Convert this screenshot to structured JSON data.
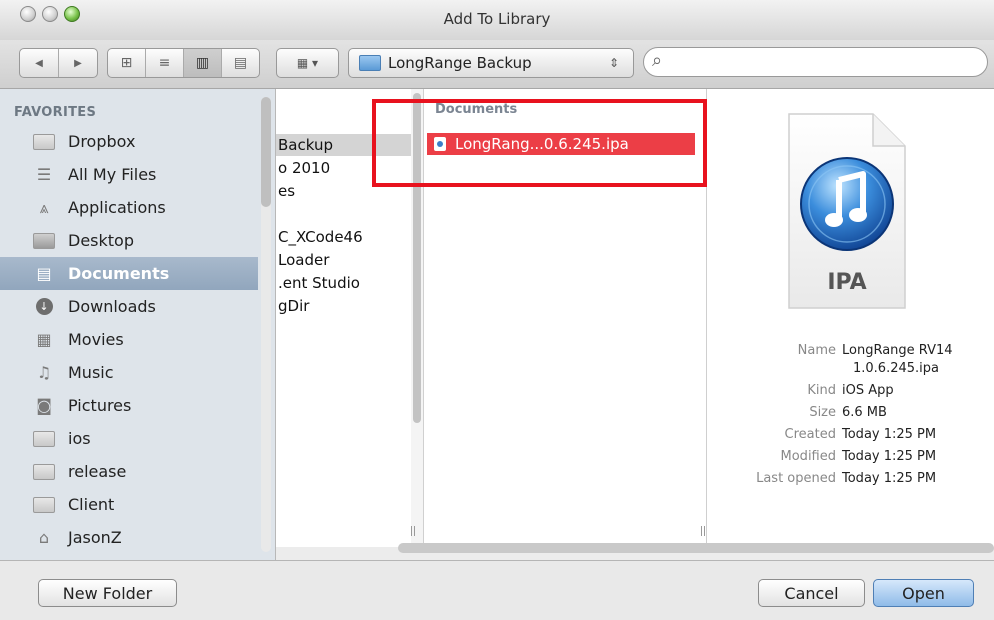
{
  "window": {
    "title": "Add To Library"
  },
  "toolbar": {
    "nav_back": "◀",
    "nav_forward": "▶",
    "view_icons": "⊞",
    "view_list": "≡",
    "view_columns": "▥",
    "view_coverflow": "▤",
    "arrange": "▦ ▾",
    "location": "LongRange Backup",
    "location_stepper": "⇕",
    "search_icon": "⌕",
    "search_placeholder": ""
  },
  "sidebar": {
    "header": "FAVORITES",
    "items": [
      {
        "label": "Dropbox",
        "icon": "folder-icon"
      },
      {
        "label": "All My Files",
        "icon": "all-files-icon"
      },
      {
        "label": "Applications",
        "icon": "applications-icon"
      },
      {
        "label": "Desktop",
        "icon": "desktop-icon"
      },
      {
        "label": "Documents",
        "icon": "documents-icon",
        "selected": true
      },
      {
        "label": "Downloads",
        "icon": "downloads-icon"
      },
      {
        "label": "Movies",
        "icon": "movies-icon"
      },
      {
        "label": "Music",
        "icon": "music-icon"
      },
      {
        "label": "Pictures",
        "icon": "pictures-icon"
      },
      {
        "label": "ios",
        "icon": "folder-icon"
      },
      {
        "label": "release",
        "icon": "folder-icon"
      },
      {
        "label": "Client",
        "icon": "folder-icon"
      },
      {
        "label": "JasonZ",
        "icon": "home-icon"
      }
    ]
  },
  "column1": {
    "items": [
      "Backup",
      "o 2010",
      "es",
      "",
      "C_XCode46",
      "Loader",
      ".ent Studio",
      "gDir"
    ]
  },
  "column2": {
    "header": "Documents",
    "file": "LongRang...0.6.245.ipa"
  },
  "preview": {
    "icon_label": "IPA",
    "name_key": "Name",
    "name_line1": "LongRange RV14",
    "name_line2": "1.0.6.245.ipa",
    "kind_key": "Kind",
    "kind": "iOS App",
    "size_key": "Size",
    "size": "6.6 MB",
    "created_key": "Created",
    "created": "Today 1:25 PM",
    "modified_key": "Modified",
    "modified": "Today 1:25 PM",
    "last_opened_key": "Last opened",
    "last_opened": "Today 1:25 PM"
  },
  "buttons": {
    "new_folder": "New Folder",
    "cancel": "Cancel",
    "open": "Open"
  },
  "colors": {
    "selection_red": "#ec3e46",
    "highlight_box": "#e8121e",
    "sidebar_selection": "#91a6bd"
  }
}
